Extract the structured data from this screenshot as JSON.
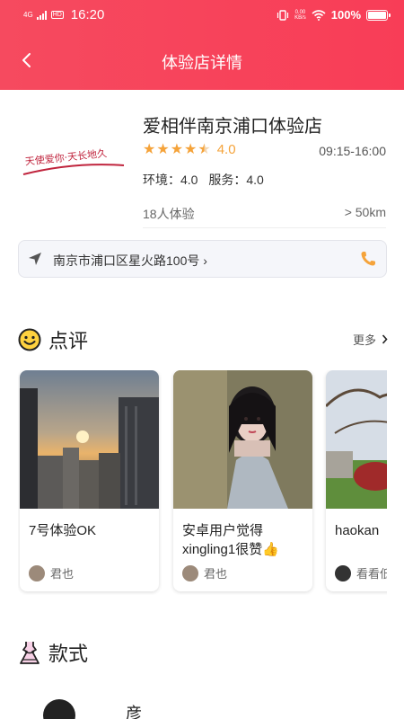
{
  "status_bar": {
    "network": "4G",
    "hd": "HD",
    "time": "16:20",
    "speed_value": "0.00",
    "speed_unit": "KB/s",
    "battery": "100%"
  },
  "nav": {
    "back_icon": "chevron-left-icon",
    "title": "体验店详情"
  },
  "store": {
    "logo_text": "天使爱你·天长地久",
    "name": "爱相伴南京浦口体验店",
    "rating": "4.0",
    "rating_value": 4.5,
    "hours": "09:15-16:00",
    "env_score": "环境：4.0",
    "service_score": "服务：4.0",
    "experience_count": "18人体验",
    "distance": "> 50km",
    "address": "南京市浦口区星火路100号 ›",
    "colors": {
      "accent": "#f5a33a",
      "phone": "#f5a33a"
    }
  },
  "reviews": {
    "title": "点评",
    "icon": "smiley-icon",
    "more": "更多",
    "items": [
      {
        "title": "7号体验OK",
        "user": "君也"
      },
      {
        "title": "安卓用户觉得xingling1很赞👍",
        "user": "君也"
      },
      {
        "title": "haokan",
        "user": "看看低"
      }
    ]
  },
  "styles": {
    "title": "款式",
    "icon": "dress-icon",
    "first_item_name": "彦"
  },
  "theme": {
    "header_gradient_start": "#f64a5f",
    "header_gradient_end": "#f83d57"
  }
}
